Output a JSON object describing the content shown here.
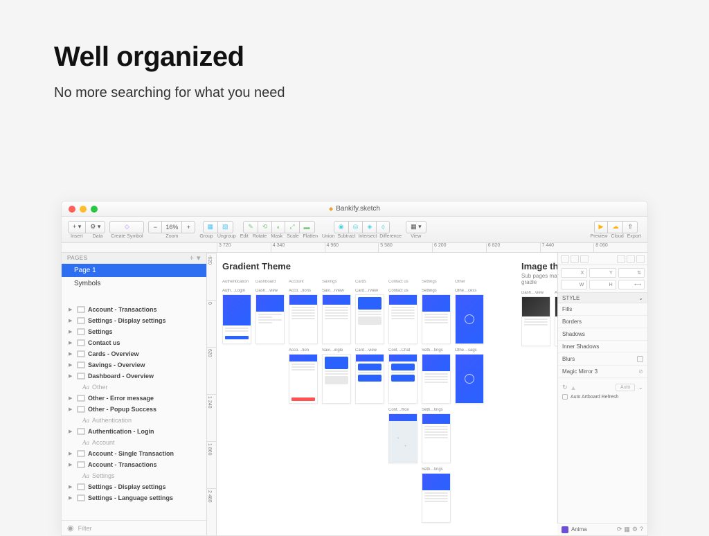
{
  "hero": {
    "title": "Well organized",
    "subtitle": "No more searching for what you need"
  },
  "window": {
    "title": "Bankify.sketch"
  },
  "toolbar": {
    "insert": "Insert",
    "data": "Data",
    "create_symbol": "Create Symbol",
    "zoom": "Zoom",
    "zoom_value": "16%",
    "group": "Group",
    "ungroup": "Ungroup",
    "edit": "Edit",
    "rotate": "Rotate",
    "mask": "Mask",
    "scale": "Scale",
    "flatten": "Flatten",
    "union": "Union",
    "subtract": "Subtract",
    "intersect": "Intersect",
    "difference": "Difference",
    "view": "View",
    "preview": "Preview",
    "cloud": "Cloud",
    "export": "Export"
  },
  "ruler_h": [
    "3 720",
    "4 340",
    "4 960",
    "5 580",
    "6 200",
    "6 820",
    "7 440",
    "8 060"
  ],
  "ruler_v": [
    "-620",
    "0",
    "620",
    "1 240",
    "1 860",
    "2 480"
  ],
  "sidebar": {
    "pages_label": "PAGES",
    "pages": [
      "Page 1",
      "Symbols"
    ],
    "layers": [
      {
        "type": "artboard",
        "label": "Account - Transactions"
      },
      {
        "type": "artboard",
        "label": "Settings - Display settings"
      },
      {
        "type": "artboard",
        "label": "Settings"
      },
      {
        "type": "artboard",
        "label": "Contact us"
      },
      {
        "type": "artboard",
        "label": "Cards - Overview"
      },
      {
        "type": "artboard",
        "label": "Savings - Overview"
      },
      {
        "type": "artboard",
        "label": "Dashboard - Overview"
      },
      {
        "type": "heading",
        "label": "Other"
      },
      {
        "type": "artboard",
        "label": "Other - Error message"
      },
      {
        "type": "artboard",
        "label": "Other - Popup Success"
      },
      {
        "type": "heading",
        "label": "Authentication"
      },
      {
        "type": "artboard",
        "label": "Authentication - Login"
      },
      {
        "type": "heading",
        "label": "Account"
      },
      {
        "type": "artboard",
        "label": "Account - Single Transaction"
      },
      {
        "type": "artboard",
        "label": "Account - Transactions"
      },
      {
        "type": "heading",
        "label": "Settings"
      },
      {
        "type": "artboard",
        "label": "Settings - Display settings"
      },
      {
        "type": "artboard",
        "label": "Settings - Language settings"
      }
    ],
    "filter_placeholder": "Filter"
  },
  "canvas": {
    "gradient_title": "Gradient Theme",
    "image_title": "Image them",
    "image_sub": "Sub pages may use gradie",
    "categories": [
      "Authentication",
      "Dashboard",
      "Account",
      "Savings",
      "Cards",
      "Contact us",
      "Settings",
      "Other"
    ],
    "row1": [
      "Auth…Login",
      "Dash…view",
      "Acco…tions",
      "Savi…rview",
      "Card…rview",
      "Contact us",
      "Settings",
      "Othe…cess"
    ],
    "row2": [
      "Acco…tion",
      "Savi…ingle",
      "Card…view",
      "Cont…Chat",
      "Setti…tings",
      "Othe…sags"
    ],
    "row3": [
      "Cont…ffice",
      "Setti…tings"
    ],
    "row4": [
      "Setti…tings"
    ],
    "image_row": [
      "Dash…view",
      "Acco…"
    ]
  },
  "inspector": {
    "props": [
      "X",
      "Y",
      "",
      "W",
      "H",
      ""
    ],
    "style_label": "STYLE",
    "sections": [
      "Fills",
      "Borders",
      "Shadows",
      "Inner Shadows",
      "Blurs"
    ],
    "magic_mirror": "Magic Mirror 3",
    "mm_auto": "Auto",
    "mm_refresh": "Auto Artboard Refresh",
    "anima": "Anima"
  }
}
